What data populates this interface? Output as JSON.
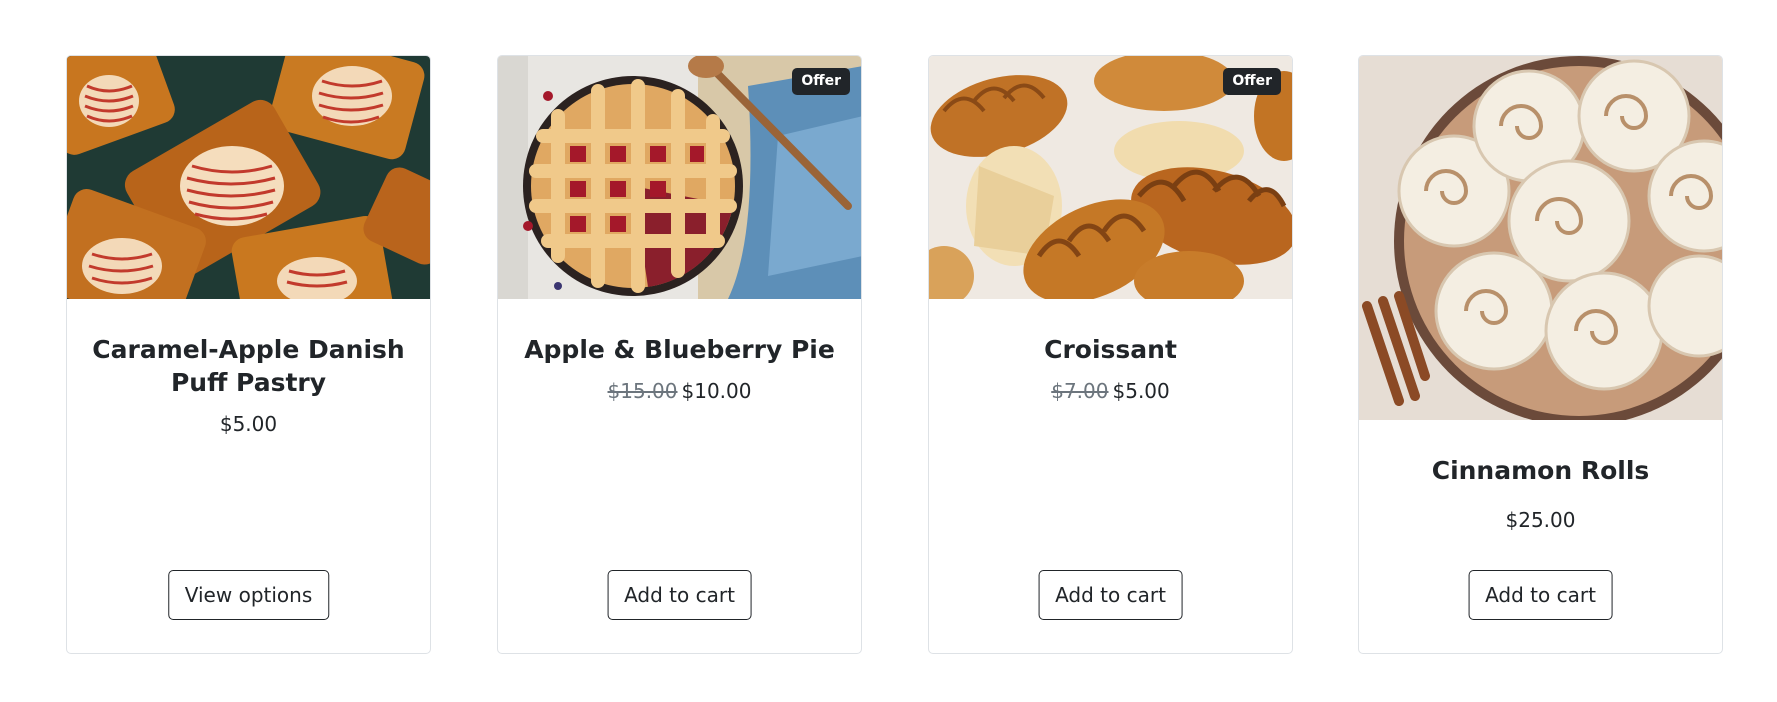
{
  "products": [
    {
      "name": "Caramel-Apple Danish Puff Pastry",
      "image_icon": "danish-pastry-photo",
      "badge": "",
      "old_price": "",
      "price": "$5.00",
      "action_label": "View options"
    },
    {
      "name": "Apple & Blueberry Pie",
      "image_icon": "lattice-pie-photo",
      "badge": "Offer",
      "old_price": "$15.00",
      "price": "$10.00",
      "action_label": "Add to cart"
    },
    {
      "name": "Croissant",
      "image_icon": "croissants-photo",
      "badge": "Offer",
      "old_price": "$7.00",
      "price": "$5.00",
      "action_label": "Add to cart"
    },
    {
      "name": "Cinnamon Rolls",
      "image_icon": "cinnamon-rolls-photo",
      "badge": "",
      "old_price": "",
      "price": "$25.00",
      "action_label": "Add to cart"
    }
  ],
  "colors": {
    "badge_bg": "#212529",
    "text": "#212529",
    "muted": "#6c757d",
    "border": "#dee2e6"
  }
}
